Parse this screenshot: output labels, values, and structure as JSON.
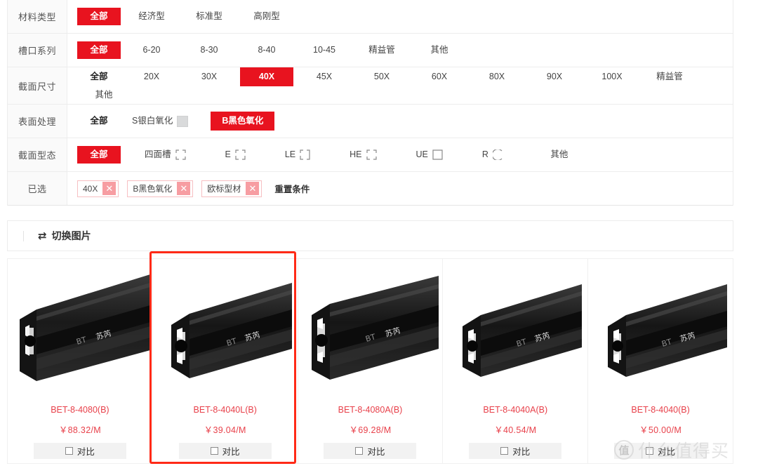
{
  "filters": {
    "rows": [
      {
        "label": "材料类型",
        "all_label": "全部",
        "all_active": true,
        "options": [
          {
            "text": "经济型"
          },
          {
            "text": "标准型"
          },
          {
            "text": "高刚型"
          }
        ]
      },
      {
        "label": "槽口系列",
        "all_label": "全部",
        "all_active": true,
        "options": [
          {
            "text": "6-20"
          },
          {
            "text": "8-30"
          },
          {
            "text": "8-40"
          },
          {
            "text": "10-45"
          },
          {
            "text": "精益管"
          },
          {
            "text": "其他"
          }
        ]
      },
      {
        "label": "截面尺寸",
        "all_label": "全部",
        "all_active": false,
        "options": [
          {
            "text": "20X"
          },
          {
            "text": "30X"
          },
          {
            "text": "40X",
            "selected": true
          },
          {
            "text": "45X"
          },
          {
            "text": "50X"
          },
          {
            "text": "60X"
          },
          {
            "text": "80X"
          },
          {
            "text": "90X"
          },
          {
            "text": "100X"
          },
          {
            "text": "精益管"
          },
          {
            "text": "其他"
          }
        ]
      },
      {
        "label": "表面处理",
        "all_label": "全部",
        "all_active": false,
        "options": [
          {
            "text": "S银白氧化",
            "swatch": "#d9dadb"
          },
          {
            "text": "B黑色氧化",
            "selected": true
          }
        ]
      },
      {
        "label": "截面型态",
        "all_label": "全部",
        "all_active": true,
        "options": [
          {
            "text": "四面槽",
            "shape": "four-slot"
          },
          {
            "text": "E",
            "shape": "e-slot"
          },
          {
            "text": "LE",
            "shape": "le-slot"
          },
          {
            "text": "HE",
            "shape": "he-slot"
          },
          {
            "text": "UE",
            "shape": "ue-slot"
          },
          {
            "text": "R",
            "shape": "r-round"
          },
          {
            "text": "其他"
          }
        ]
      }
    ],
    "selected_row": {
      "label": "已选",
      "chips": [
        {
          "text": "40X",
          "close": "✕"
        },
        {
          "text": "B黑色氧化",
          "close": "✕"
        },
        {
          "text": "欧标型材",
          "close": "✕"
        }
      ],
      "reset_label": "重置条件"
    }
  },
  "toolbar": {
    "toggle_images_label": "切换图片",
    "toggle_icon": "⇄"
  },
  "products": [
    {
      "title": "BET-8-4080(B)",
      "price": "￥88.32/M",
      "compare_label": "对比",
      "highlighted": false
    },
    {
      "title": "BET-8-4040L(B)",
      "price": "￥39.04/M",
      "compare_label": "对比",
      "highlighted": true
    },
    {
      "title": "BET-8-4080A(B)",
      "price": "￥69.28/M",
      "compare_label": "对比",
      "highlighted": false
    },
    {
      "title": "BET-8-4040A(B)",
      "price": "￥40.54/M",
      "compare_label": "对比",
      "highlighted": false
    },
    {
      "title": "BET-8-4040(B)",
      "price": "￥50.00/M",
      "compare_label": "对比",
      "highlighted": false
    }
  ],
  "watermark": {
    "logo_char": "值",
    "text": "什么值得买"
  },
  "colors": {
    "accent_red": "#e8131f",
    "title_red": "#e8404a",
    "highlight_red": "#ff2a17"
  }
}
